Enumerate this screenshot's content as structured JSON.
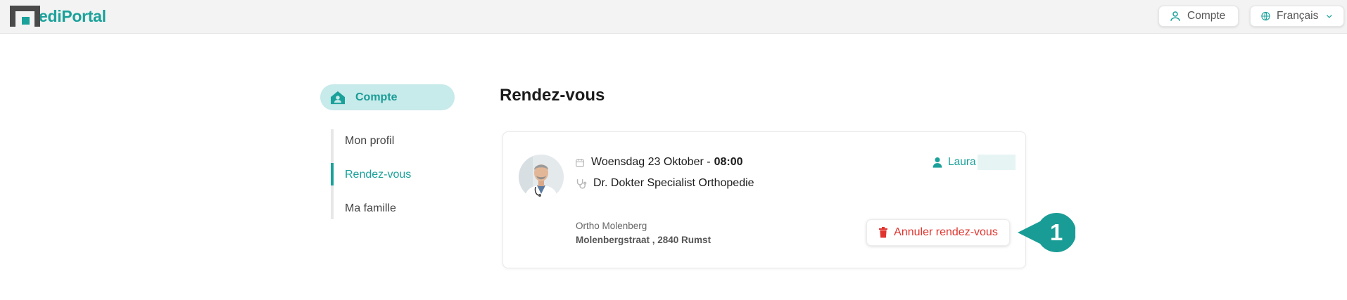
{
  "app": {
    "logo_text": "ediPortal"
  },
  "topbar": {
    "account_label": "Compte",
    "language_label": "Français"
  },
  "sidebar": {
    "header_label": "Compte",
    "items": [
      {
        "label": "Mon profil",
        "active": false
      },
      {
        "label": "Rendez-vous",
        "active": true
      },
      {
        "label": "Ma famille",
        "active": false
      }
    ]
  },
  "main": {
    "title": "Rendez-vous",
    "appointment": {
      "date_text": "Woensdag 23 Oktober -",
      "time": "08:00",
      "doctor": "Dr. Dokter Specialist Orthopedie",
      "patient_name": "Laura",
      "clinic_name": "Ortho Molenberg",
      "clinic_address": "Molenbergstraat , 2840 Rumst",
      "cancel_label": "Annuler rendez-vous"
    }
  },
  "callout": {
    "number": "1"
  },
  "colors": {
    "accent": "#1aa19a",
    "accent_light": "#c7eaea",
    "danger": "#e0352f",
    "logo_dark": "#4a4a4a"
  }
}
